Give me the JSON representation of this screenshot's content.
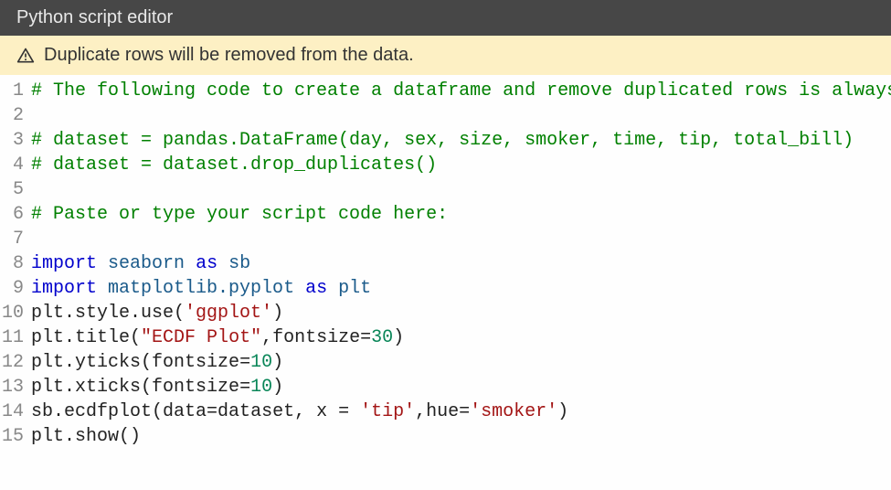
{
  "header": {
    "title": "Python script editor"
  },
  "warning": {
    "text": "Duplicate rows will be removed from the data."
  },
  "editor": {
    "lines": [
      {
        "n": "1"
      },
      {
        "n": "2"
      },
      {
        "n": "3"
      },
      {
        "n": "4"
      },
      {
        "n": "5"
      },
      {
        "n": "6"
      },
      {
        "n": "7"
      },
      {
        "n": "8"
      },
      {
        "n": "9"
      },
      {
        "n": "10"
      },
      {
        "n": "11"
      },
      {
        "n": "12"
      },
      {
        "n": "13"
      },
      {
        "n": "14"
      },
      {
        "n": "15"
      }
    ],
    "code": {
      "l1": "# The following code to create a dataframe and remove duplicated rows is always",
      "l2": "",
      "l3": "# dataset = pandas.DataFrame(day, sex, size, smoker, time, tip, total_bill)",
      "l4": "# dataset = dataset.drop_duplicates()",
      "l5": "",
      "l6": "# Paste or type your script code here:",
      "l7": "",
      "l8_import": "import",
      "l8_mod": "seaborn",
      "l8_as": "as",
      "l8_alias": "sb",
      "l9_import": "import",
      "l9_mod": "matplotlib.pyplot",
      "l9_as": "as",
      "l9_alias": "plt",
      "l10_a": "plt.style.use",
      "l10_s": "'ggplot'",
      "l11_a": "plt.title",
      "l11_s": "\"ECDF Plot\"",
      "l11_kw": ",fontsize=",
      "l11_n": "30",
      "l12_a": "plt.yticks",
      "l12_kw": "fontsize=",
      "l12_n": "10",
      "l13_a": "plt.xticks",
      "l13_kw": "fontsize=",
      "l13_n": "10",
      "l14_a": "sb.ecdfplot",
      "l14_p1": "data=dataset, x = ",
      "l14_s1": "'tip'",
      "l14_p2": ",hue=",
      "l14_s2": "'smoker'",
      "l15_a": "plt.show",
      "paren_open": "(",
      "paren_close": ")"
    }
  }
}
